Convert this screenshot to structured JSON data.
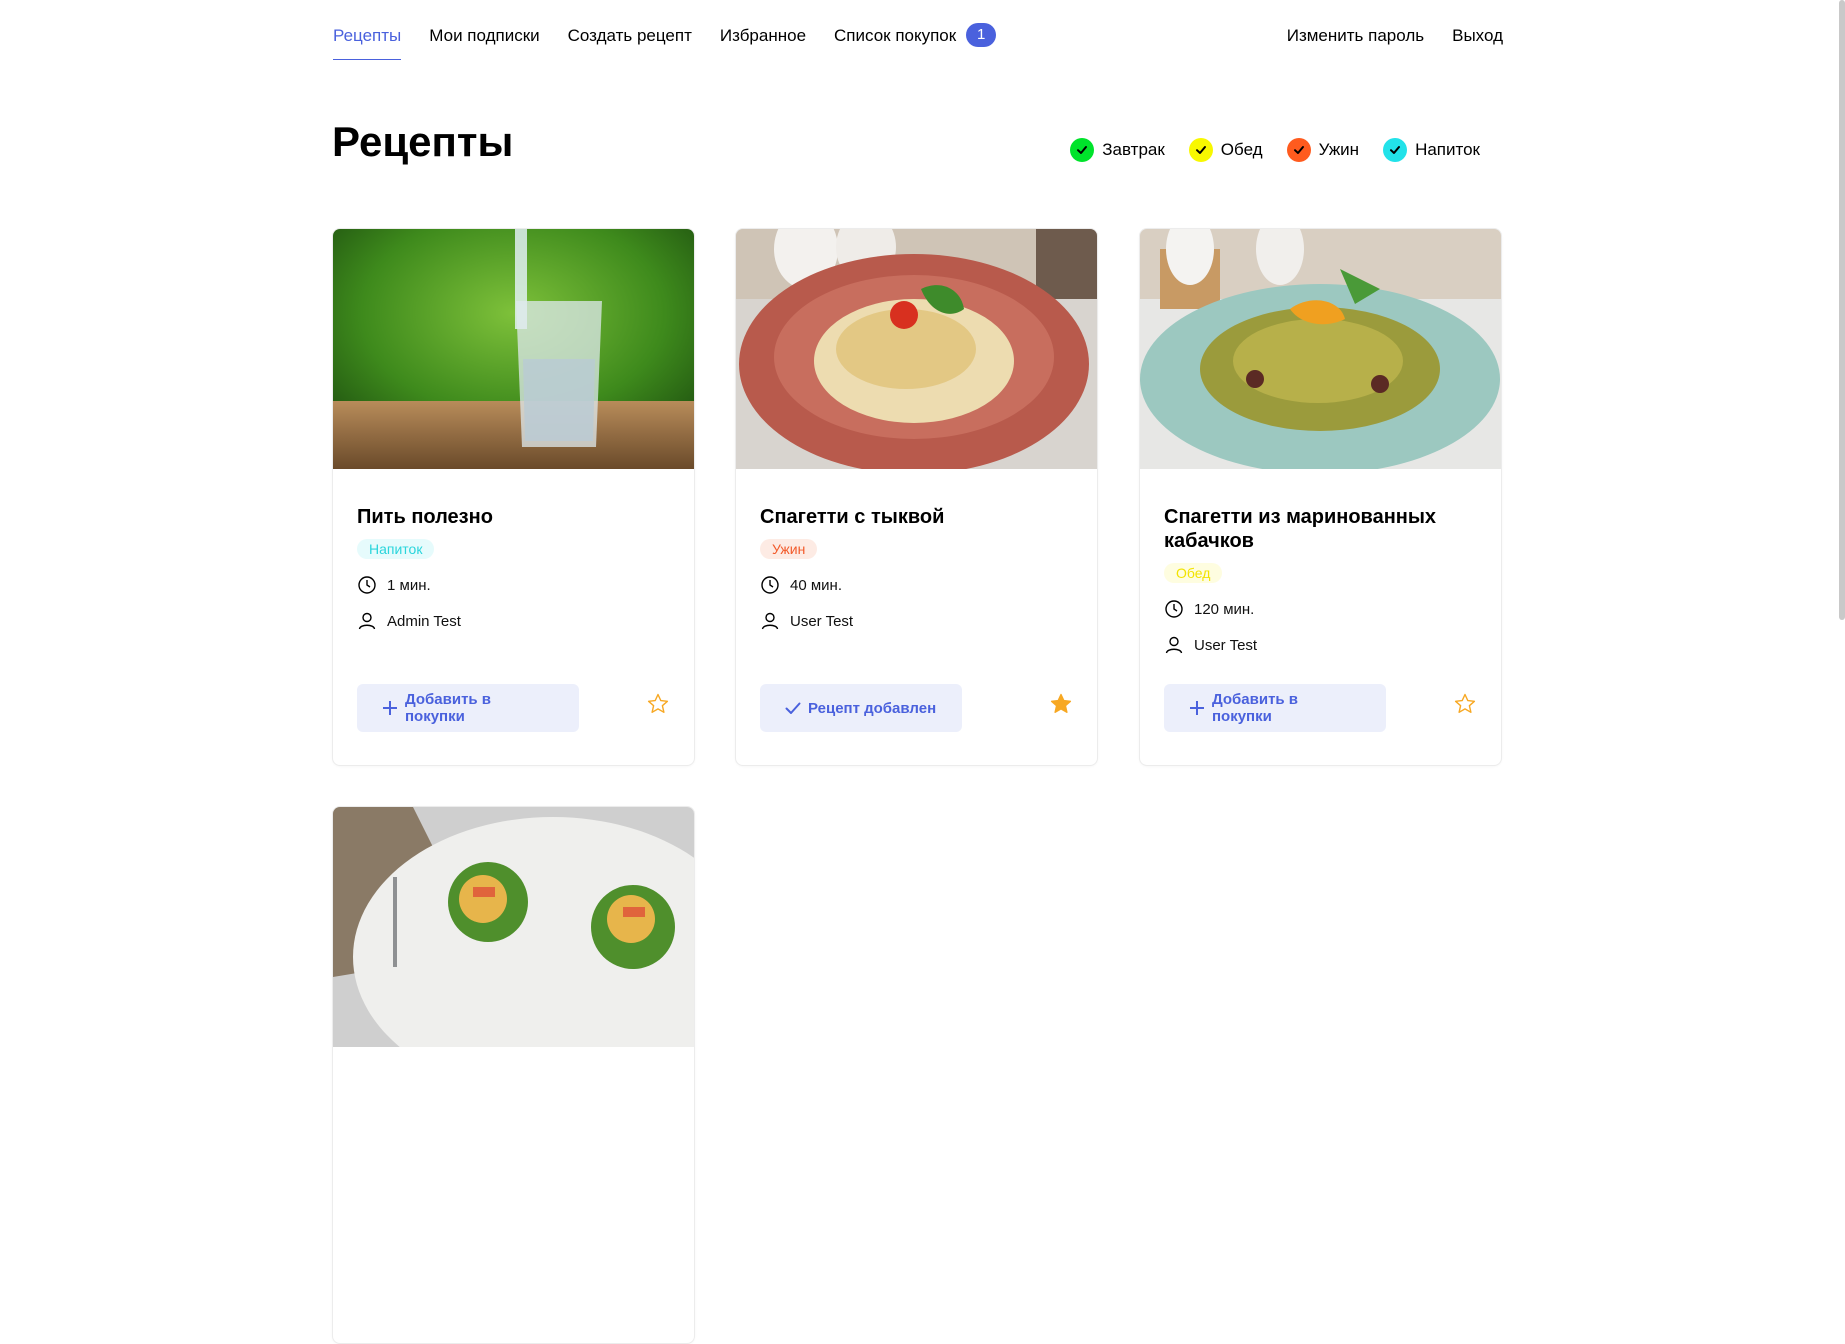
{
  "nav": {
    "items": [
      {
        "label": "Рецепты",
        "active": true
      },
      {
        "label": "Мои подписки"
      },
      {
        "label": "Создать рецепт"
      },
      {
        "label": "Избранное"
      },
      {
        "label": "Список покупок",
        "badge": "1"
      }
    ],
    "right": [
      {
        "label": "Изменить пароль"
      },
      {
        "label": "Выход"
      }
    ]
  },
  "page_title": "Рецепты",
  "filters": [
    {
      "label": "Завтрак",
      "color": "#00e32b"
    },
    {
      "label": "Обед",
      "color": "#f8f800"
    },
    {
      "label": "Ужин",
      "color": "#ff5b1e"
    },
    {
      "label": "Напиток",
      "color": "#22e2e9"
    }
  ],
  "cards": [
    {
      "title": "Пить полезно",
      "tag": "Напиток",
      "tag_color": "#2ad5dc",
      "tag_bg": "#e6fbfc",
      "time": "1 мин.",
      "author": "Admin Test",
      "button_label": "Добавить в покупки",
      "button_icon": "plus-icon",
      "favorite": false,
      "image": "glass-of-water"
    },
    {
      "title": "Спагетти с тыквой",
      "tag": "Ужин",
      "tag_color": "#f25a2a",
      "tag_bg": "#fdebe4",
      "time": "40 мин.",
      "author": "User Test",
      "button_label": "Рецепт добавлен",
      "button_icon": "check-icon",
      "favorite": true,
      "image": "pasta-red-bowl"
    },
    {
      "title": "Спагетти из маринованных кабачков",
      "tag": "Обед",
      "tag_color": "#f2e300",
      "tag_bg": "#fefde0",
      "time": "120 мин.",
      "author": "User Test",
      "button_label": "Добавить в покупки",
      "button_icon": "plus-icon",
      "favorite": false,
      "image": "zucchini-spaghetti"
    },
    {
      "image": "salmon-lettuce-plate"
    }
  ],
  "accent_color": "#4a61dd",
  "star_color": "#f7a823"
}
